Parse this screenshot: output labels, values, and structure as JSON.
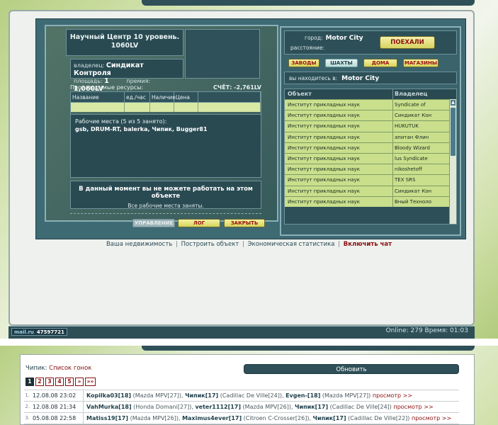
{
  "building": {
    "title_line1": "Научный Центр 10 уровень.",
    "title_line2": "1060LV",
    "owner_label": "владелец:",
    "owner_value": "Синдикат Контроля",
    "area_label": "площадь:",
    "area_value": "1",
    "rent_label": "премия:",
    "rent_value": "1,060LV",
    "resources_label": "Производимые ресурсы:",
    "score_label": "СЧЁТ: -2,761LV",
    "res_headers": [
      "Название",
      "ед./час",
      "Наличие",
      "Цена",
      ""
    ],
    "workplaces_label": "Рабочие места (5 из 5 занято):",
    "workers": "gsb, DRUM-RT, balerka, Чипик, Bugger81",
    "msg_line1": "В данный момент вы не можете работать на этом объекте",
    "msg_line2": "Все рабочие места заняты.",
    "buttons": {
      "manage": "УПРАВЛЕНИЕ",
      "log": "ЛОГ",
      "close": "ЗАКРЫТЬ"
    }
  },
  "city": {
    "city_label": "город:",
    "city_value": "Motor City",
    "distance_label": "расстояние:",
    "go_button": "ПОЕХАЛИ",
    "nav": [
      "ЗАВОДЫ",
      "ШАХТЫ",
      "ДОМА",
      "МАГАЗИНЫ"
    ],
    "here_label": "вы находитесь в:",
    "here_value": "Motor City",
    "list_headers": [
      "Объект",
      "Владелец"
    ],
    "objects": [
      {
        "name": "Институт прикладных наук",
        "owner": "Syndicate of"
      },
      {
        "name": "Институт прикладных наук",
        "owner": "Синдикат Кон"
      },
      {
        "name": "Институт прикладных наук",
        "owner": "HUKUTUK"
      },
      {
        "name": "Институт прикладных наук",
        "owner": "апитан Флин"
      },
      {
        "name": "Институт прикладных наук",
        "owner": "Bloody Wizard"
      },
      {
        "name": "Институт прикладных наук",
        "owner": "lus Syndicate"
      },
      {
        "name": "Институт прикладных наук",
        "owner": "nikoshetoff"
      },
      {
        "name": "Институт прикладных наук",
        "owner": "TEX SRS"
      },
      {
        "name": "Институт прикладных наук",
        "owner": "Синдикат Кон"
      },
      {
        "name": "Институт прикладных наук",
        "owner": "Вный Техноло"
      }
    ]
  },
  "footer": {
    "link1": "Ваша недвижимость",
    "link2": "Построить объект",
    "link3": "Экономическая статистика",
    "chat": "Включить чат",
    "sep": "|"
  },
  "status": {
    "logo": "mail.ru",
    "counter": "47597721",
    "online": "Online: 279  Время: 01:03"
  },
  "races": {
    "nick": "Чипик:",
    "title": "Список гонок",
    "refresh": "Обновить",
    "pages": [
      "1",
      "2",
      "3",
      "4",
      "5",
      "»",
      "»»"
    ],
    "rows": [
      {
        "idx": "1.",
        "date": "12.08.08 23:02",
        "p1": "Kopilka03[18]",
        "c1": " (Mazda MPV[27]), ",
        "p2": "Чипик[17]",
        "c2": " (Cadillac De Ville[24]), ",
        "p3": "Evgen-[18]",
        "c3": " (Mazda MPV[27]) ",
        "view": "просмотр >>"
      },
      {
        "idx": "2.",
        "date": "12.08.08 21:34",
        "p1": "VahMurka[18]",
        "c1": " (Honda Domani[27]), ",
        "p2": "veter1112[17]",
        "c2": " (Mazda MPV[26]), ",
        "p3": "Чипик[17]",
        "c3": " (Cadillac De Ville[24]) ",
        "view": "просмотр >>"
      },
      {
        "idx": "3.",
        "date": "05.08.08 22:58",
        "p1": "Matiss19[17]",
        "c1": " (Mazda MPV[26]), ",
        "p2": "Maximus4ever[17]",
        "c2": " (Citroen C-Crosser[26]), ",
        "p3": "Чипик[17]",
        "c3": " (Cadillac De Ville[22]) ",
        "view": "просмотр >>"
      }
    ]
  }
}
